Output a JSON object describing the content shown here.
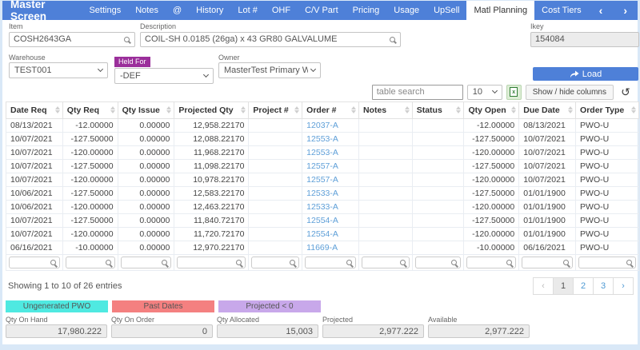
{
  "nav": {
    "title": "Master Screen",
    "items": [
      "Settings",
      "Notes",
      "@",
      "History",
      "Lot #",
      "OHF",
      "C/V Part",
      "Pricing",
      "Usage",
      "UpSell",
      "Matl Planning",
      "Cost Tiers"
    ],
    "active": "Matl Planning",
    "prev_arrow": "‹",
    "next_arrow": "›"
  },
  "form": {
    "item": {
      "label": "Item",
      "value": "COSH2643GA"
    },
    "description": {
      "label": "Description",
      "value": "COIL-SH 0.0185 (26ga) x 43 GR80 GALVALUME"
    },
    "ikey": {
      "label": "Ikey",
      "value": "154084"
    },
    "warehouse": {
      "label": "Warehouse",
      "value": "TEST001"
    },
    "held_for": {
      "label": "Held For",
      "value": "-DEF"
    },
    "owner": {
      "label": "Owner",
      "value": "MasterTest Primary Wareho"
    },
    "load_button": "Load"
  },
  "table_controls": {
    "search_placeholder": "table search",
    "page_size": "10",
    "show_hide_label": "Show / hide columns",
    "refresh_icon": "↺"
  },
  "table": {
    "columns": [
      "Date Req",
      "Qty Req",
      "Qty Issue",
      "Projected Qty",
      "Project #",
      "Order #",
      "Notes",
      "Status",
      "Qty Open",
      "Due Date",
      "Order Type"
    ],
    "rows": [
      [
        "08/13/2021",
        "-12.00000",
        "0.00000",
        "12,958.22170",
        "",
        "12037-A",
        "",
        "",
        "-12.00000",
        "08/13/2021",
        "PWO-U"
      ],
      [
        "10/07/2021",
        "-127.50000",
        "0.00000",
        "12,088.22170",
        "",
        "12553-A",
        "",
        "",
        "-127.50000",
        "10/07/2021",
        "PWO-U"
      ],
      [
        "10/07/2021",
        "-120.00000",
        "0.00000",
        "11,968.22170",
        "",
        "12553-A",
        "",
        "",
        "-120.00000",
        "10/07/2021",
        "PWO-U"
      ],
      [
        "10/07/2021",
        "-127.50000",
        "0.00000",
        "11,098.22170",
        "",
        "12557-A",
        "",
        "",
        "-127.50000",
        "10/07/2021",
        "PWO-U"
      ],
      [
        "10/07/2021",
        "-120.00000",
        "0.00000",
        "10,978.22170",
        "",
        "12557-A",
        "",
        "",
        "-120.00000",
        "10/07/2021",
        "PWO-U"
      ],
      [
        "10/06/2021",
        "-127.50000",
        "0.00000",
        "12,583.22170",
        "",
        "12533-A",
        "",
        "",
        "-127.50000",
        "01/01/1900",
        "PWO-U"
      ],
      [
        "10/06/2021",
        "-120.00000",
        "0.00000",
        "12,463.22170",
        "",
        "12533-A",
        "",
        "",
        "-120.00000",
        "01/01/1900",
        "PWO-U"
      ],
      [
        "10/07/2021",
        "-127.50000",
        "0.00000",
        "11,840.72170",
        "",
        "12554-A",
        "",
        "",
        "-127.50000",
        "01/01/1900",
        "PWO-U"
      ],
      [
        "10/07/2021",
        "-120.00000",
        "0.00000",
        "11,720.72170",
        "",
        "12554-A",
        "",
        "",
        "-120.00000",
        "01/01/1900",
        "PWO-U"
      ],
      [
        "06/16/2021",
        "-10.00000",
        "0.00000",
        "12,970.22170",
        "",
        "11669-A",
        "",
        "",
        "-10.00000",
        "06/16/2021",
        "PWO-U"
      ]
    ]
  },
  "footer": {
    "showing_text": "Showing 1 to 10 of 26 entries",
    "pagination": {
      "prev": "‹",
      "pages": [
        "1",
        "2",
        "3"
      ],
      "active": "1",
      "next": "›"
    },
    "legend": [
      {
        "label": "Ungenerated PWO",
        "color": "#4fe9e1"
      },
      {
        "label": "Past Dates",
        "color": "#f48080"
      },
      {
        "label": "Projected < 0",
        "color": "#c8a8ea"
      }
    ],
    "summary": [
      {
        "label": "Qty On Hand",
        "value": "17,980.222"
      },
      {
        "label": "Qty On Order",
        "value": "0"
      },
      {
        "label": "Qty Allocated",
        "value": "15,003"
      },
      {
        "label": "Projected",
        "value": "2,977.222"
      },
      {
        "label": "Available",
        "value": "2,977.222"
      }
    ]
  }
}
